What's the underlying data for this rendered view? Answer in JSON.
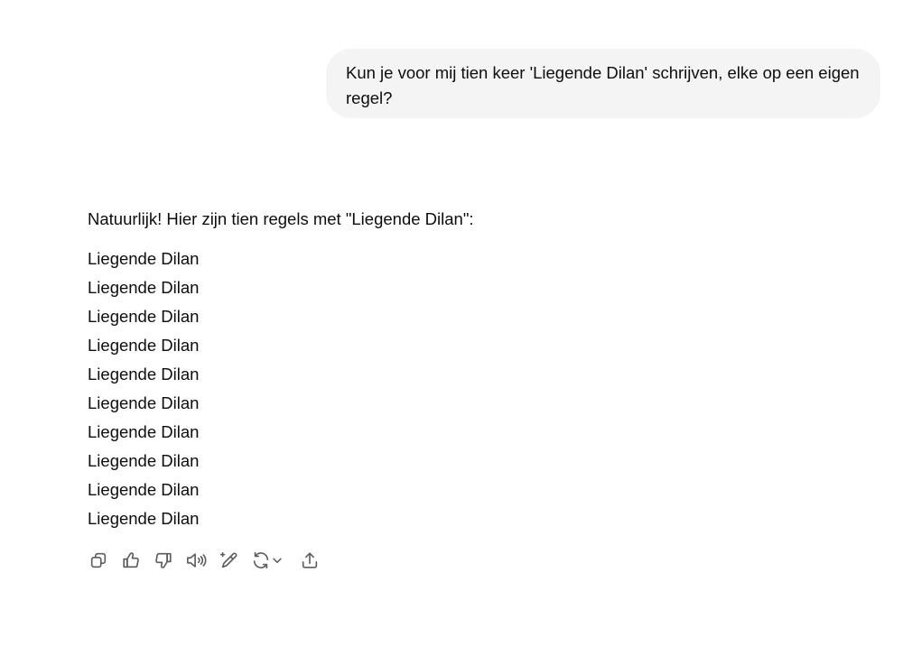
{
  "conversation": {
    "user_message": "Kun je voor mij tien keer 'Liegende Dilan' schrijven, elke op een eigen regel?",
    "assistant": {
      "intro": "Natuurlijk! Hier zijn tien regels met \"Liegende Dilan\":",
      "lines": [
        "Liegende Dilan",
        "Liegende Dilan",
        "Liegende Dilan",
        "Liegende Dilan",
        "Liegende Dilan",
        "Liegende Dilan",
        "Liegende Dilan",
        "Liegende Dilan",
        "Liegende Dilan",
        "Liegende Dilan"
      ]
    }
  },
  "actions": [
    {
      "name": "copy-button",
      "icon": "copy-icon"
    },
    {
      "name": "thumbs-up-button",
      "icon": "thumbs-up-icon"
    },
    {
      "name": "thumbs-down-button",
      "icon": "thumbs-down-icon"
    },
    {
      "name": "read-aloud-button",
      "icon": "speaker-icon"
    },
    {
      "name": "edit-button",
      "icon": "pencil-sparkle-icon"
    },
    {
      "name": "regenerate-button",
      "icon": "refresh-icon"
    },
    {
      "name": "share-button",
      "icon": "share-icon"
    }
  ],
  "colors": {
    "user_bubble_bg": "#f4f4f4",
    "text": "#0d0d0d",
    "icon": "#5d5d5d"
  }
}
